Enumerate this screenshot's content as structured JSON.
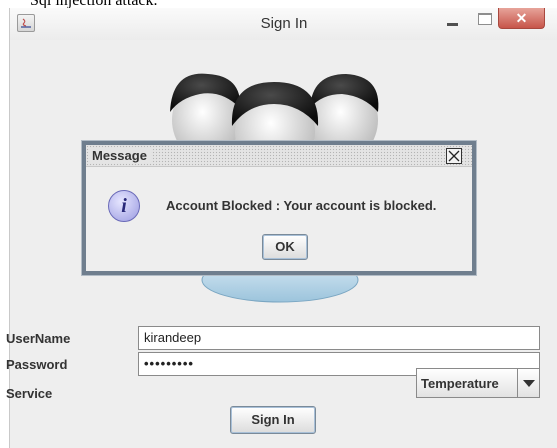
{
  "caption": "Sql injection attack.",
  "window": {
    "title": "Sign In",
    "close_glyph": "✕"
  },
  "dialog": {
    "title": "Message",
    "icon": "info-icon",
    "icon_glyph": "i",
    "message": "Account Blocked : Your account is blocked.",
    "ok_label": "OK"
  },
  "form": {
    "username_label": "UserName",
    "username_value": "kirandeep",
    "password_label": "Password",
    "password_value": "•••••••••",
    "service_label": "Service",
    "service_value": "Temperature",
    "signin_label": "Sign In"
  }
}
